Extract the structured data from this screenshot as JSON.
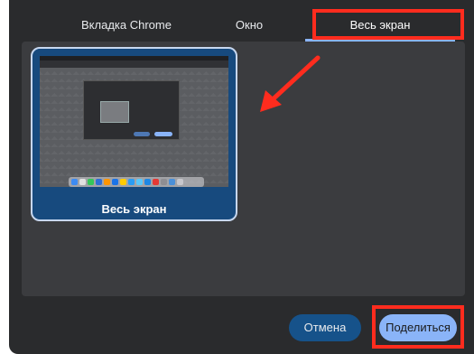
{
  "tabs": [
    {
      "label": "Вкладка Chrome"
    },
    {
      "label": "Окно"
    },
    {
      "label": "Весь экран"
    }
  ],
  "selected_source": {
    "label": "Весь экран"
  },
  "buttons": {
    "cancel_label": "Отмена",
    "share_label": "Поделиться"
  },
  "colors": {
    "dialog_background": "#2a2b2d",
    "accent": "#8ab4f8",
    "annotation": "#ff2c1e"
  }
}
